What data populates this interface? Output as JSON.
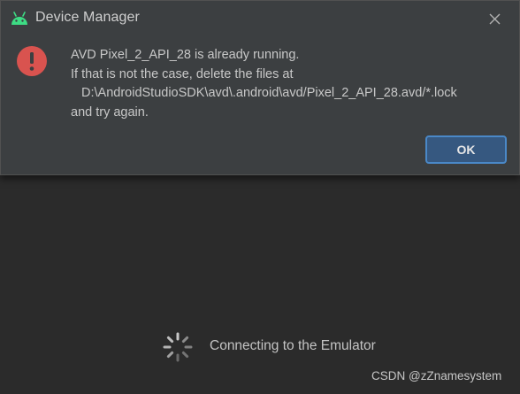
{
  "dialog": {
    "title": "Device Manager",
    "app_icon": "android-icon",
    "close_icon": "close-icon",
    "error_icon": "error-icon",
    "message_lines": [
      "AVD Pixel_2_API_28 is already running.",
      "If that is not the case, delete the files at",
      "D:\\AndroidStudioSDK\\avd\\.android\\avd/Pixel_2_API_28.avd/*.lock",
      "and try again."
    ],
    "ok_label": "OK"
  },
  "background": {
    "status_text": "Connecting to the Emulator",
    "spinner_icon": "loading-spinner-icon"
  },
  "watermark": "CSDN @zZnamesystem",
  "colors": {
    "background": "#2b2b2b",
    "dialog": "#3c3f41",
    "error_red": "#d9534f",
    "android_green": "#3ddc84",
    "ok_button": "#365880",
    "ok_border": "#4a88c7"
  }
}
